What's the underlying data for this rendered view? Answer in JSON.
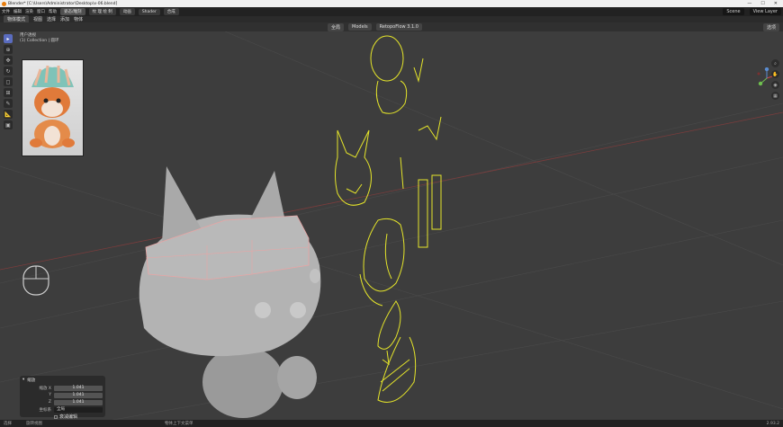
{
  "window": {
    "title": "Blender* [C:\\Users\\Administrator\\Desktop\\x-06.blend]",
    "minimize": "—",
    "maximize": "☐",
    "close": "✕"
  },
  "menu": {
    "items": [
      "文件",
      "编辑",
      "渲染",
      "窗口",
      "帮助"
    ],
    "workspace_tabs": [
      "姿态/雕刻",
      "纹 理 绘 制",
      "动画",
      "Shader",
      "合成"
    ],
    "scene": "Scene",
    "view_layer": "View Layer"
  },
  "toolheader": {
    "items": [
      "物体模式",
      "视图",
      "选择",
      "添加",
      "物体"
    ]
  },
  "header": {
    "mode": "全局",
    "snap_label": "Models",
    "addon": "RetopoFlow 3.1.0",
    "view_options": "选项"
  },
  "viewport": {
    "overlay_line1": "用户透视",
    "overlay_line2": "(1) Collection | 圆环"
  },
  "operator_panel": {
    "title": "缩放",
    "rows": [
      {
        "label": "缩放 X",
        "value": "1.041"
      },
      {
        "label": "Y",
        "value": "1.041"
      },
      {
        "label": "Z",
        "value": "1.041"
      }
    ],
    "orientation_label": "坐标系",
    "orientation_value": "全局",
    "checkbox_label": "衰减编辑"
  },
  "statusbar": {
    "left1": "选择",
    "left2": "旋转视图",
    "middle": "物体上下文菜单",
    "right": "2.93.2"
  },
  "colors": {
    "accent": "#5a6cbf",
    "sketch": "#e5e52a",
    "mesh": "#b3b3b3"
  }
}
